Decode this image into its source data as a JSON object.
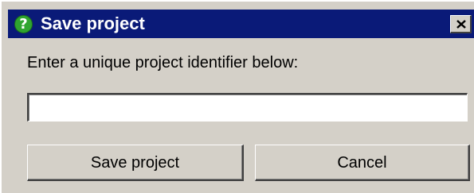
{
  "dialog": {
    "title": "Save project",
    "title_icon": "help-question-icon",
    "close_icon": "close-icon",
    "prompt": "Enter a unique project identifier below:",
    "input": {
      "value": "",
      "placeholder": ""
    },
    "buttons": {
      "save_label": "Save project",
      "cancel_label": "Cancel"
    }
  },
  "colors": {
    "titlebar": "#0a1a78",
    "title_text": "#ffffff",
    "help_icon": "#2fa52f",
    "dialog_bg": "#d4d0c8"
  }
}
